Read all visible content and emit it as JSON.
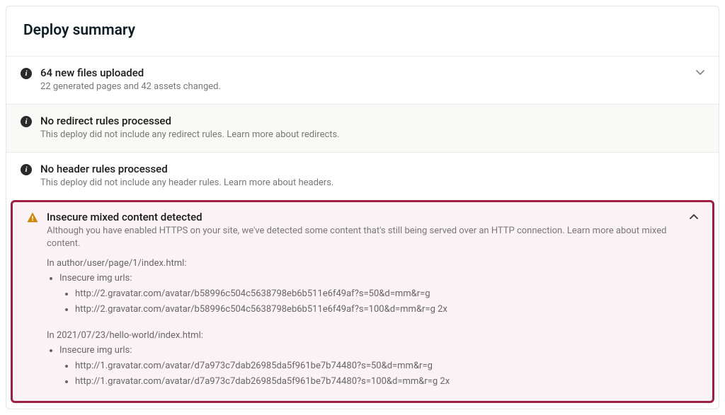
{
  "header": {
    "title": "Deploy summary"
  },
  "items": [
    {
      "icon": "info",
      "title": "64 new files uploaded",
      "subtitle": "22 generated pages and 42 assets changed.",
      "expandable": true,
      "expanded": false,
      "shaded": false
    },
    {
      "icon": "info",
      "title": "No redirect rules processed",
      "subtitle_pre": "This deploy did not include any redirect rules. ",
      "subtitle_link": "Learn more about redirects.",
      "shaded": true
    },
    {
      "icon": "info",
      "title": "No header rules processed",
      "subtitle_pre": "This deploy did not include any header rules. ",
      "subtitle_link": "Learn more about headers.",
      "shaded": false
    },
    {
      "icon": "warn",
      "title": "Insecure mixed content detected",
      "subtitle_pre": "Although you have enabled HTTPS on your site, we've detected some content that's still being served over an HTTP connection. ",
      "subtitle_link": "Learn more about mixed content.",
      "expandable": true,
      "expanded": true,
      "highlighted": true,
      "details": [
        {
          "file": "In author/user/page/1/index.html:",
          "label": "Insecure img urls:",
          "urls": [
            "http://2.gravatar.com/avatar/b58996c504c5638798eb6b511e6f49af?s=50&d=mm&r=g",
            "http://2.gravatar.com/avatar/b58996c504c5638798eb6b511e6f49af?s=100&d=mm&r=g 2x"
          ]
        },
        {
          "file": "In 2021/07/23/hello-world/index.html:",
          "label": "Insecure img urls:",
          "urls": [
            "http://1.gravatar.com/avatar/d7a973c7dab26985da5f961be7b74480?s=50&d=mm&r=g",
            "http://1.gravatar.com/avatar/d7a973c7dab26985da5f961be7b74480?s=100&d=mm&r=g 2x"
          ]
        }
      ]
    }
  ]
}
